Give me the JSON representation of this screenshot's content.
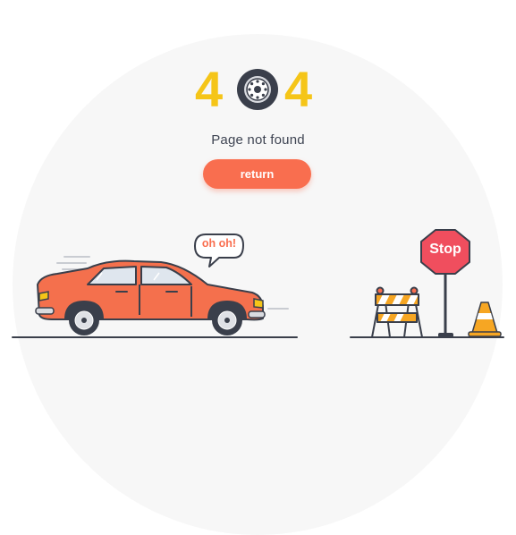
{
  "error_code": {
    "digit_left": "4",
    "digit_right": "4"
  },
  "title": "Page not found",
  "return_button": {
    "label": "return"
  },
  "scene": {
    "speech_bubble": "oh oh!",
    "stop_sign": "Stop"
  },
  "colors": {
    "accent": "#f96e4f",
    "digits": "#f5c518",
    "car_body": "#f4704d",
    "text_dark": "#3e4452",
    "outline": "#3a3f4b"
  },
  "icons": [
    "wheel-icon",
    "car-icon",
    "speech-bubble-icon",
    "stop-sign-icon",
    "road-barrier-icon",
    "traffic-cone-icon"
  ]
}
